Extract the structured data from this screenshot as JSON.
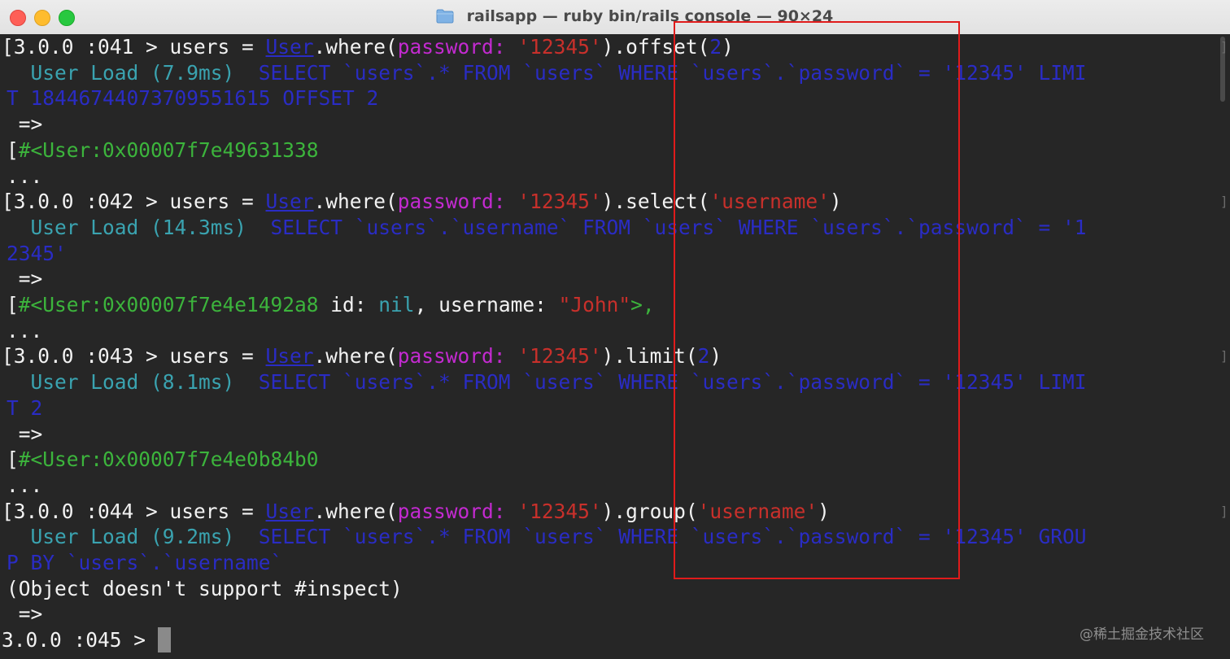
{
  "window": {
    "title": "railsapp — ruby bin/rails console — 90×24",
    "title_icon": "folder-icon",
    "close_glyph": "×"
  },
  "colors": {
    "background": "#262626",
    "prompt": "#f2f2f2",
    "log_label": "#3aa3b0",
    "sql": "#2a2cc4",
    "symbol_key": "#c32ad0",
    "string": "#c8302b",
    "object": "#3cb43c",
    "highlight_box": "#e01b1b"
  },
  "terminal": {
    "lines": [
      [
        {
          "t": "[3.0.0 :041 > users = ",
          "c": "white"
        },
        {
          "t": "User",
          "c": "blue",
          "u": true
        },
        {
          "t": ".where(",
          "c": "white"
        },
        {
          "t": "password: ",
          "c": "purple"
        },
        {
          "t": "'12345'",
          "c": "red"
        },
        {
          "t": ").offset(",
          "c": "white"
        },
        {
          "t": "2",
          "c": "blue"
        },
        {
          "t": ")",
          "c": "white"
        }
      ],
      [
        {
          "t": "  User Load (7.9ms)  ",
          "c": "cyan"
        },
        {
          "t": "SELECT `users`.* FROM `users` WHERE `users`.`password` = '12345' LIMI",
          "c": "blue"
        }
      ],
      [
        {
          "t": "T 18446744073709551615 OFFSET 2",
          "c": "blue"
        }
      ],
      [
        {
          "t": " =>",
          "c": "white"
        }
      ],
      [
        {
          "t": "[",
          "c": "white"
        },
        {
          "t": "#<User:0x00007f7e49631338",
          "c": "green"
        }
      ],
      [
        {
          "t": "...",
          "c": "white"
        }
      ],
      [
        {
          "t": "[3.0.0 :042 > users = ",
          "c": "white"
        },
        {
          "t": "User",
          "c": "blue",
          "u": true
        },
        {
          "t": ".where(",
          "c": "white"
        },
        {
          "t": "password: ",
          "c": "purple"
        },
        {
          "t": "'12345'",
          "c": "red"
        },
        {
          "t": ").select(",
          "c": "white"
        },
        {
          "t": "'username'",
          "c": "red"
        },
        {
          "t": ")",
          "c": "white"
        }
      ],
      [
        {
          "t": "  User Load (14.3ms)  ",
          "c": "cyan"
        },
        {
          "t": "SELECT `users`.`username` FROM `users` WHERE `users`.`password` = '1",
          "c": "blue"
        }
      ],
      [
        {
          "t": "2345'",
          "c": "blue"
        }
      ],
      [
        {
          "t": " =>",
          "c": "white"
        }
      ],
      [
        {
          "t": "[",
          "c": "white"
        },
        {
          "t": "#<User:0x00007f7e4e1492a8",
          "c": "green"
        },
        {
          "t": " id: ",
          "c": "white"
        },
        {
          "t": "nil",
          "c": "cyan"
        },
        {
          "t": ", username: ",
          "c": "white"
        },
        {
          "t": "\"John\"",
          "c": "red"
        },
        {
          "t": ">,",
          "c": "green"
        }
      ],
      [
        {
          "t": "...",
          "c": "white"
        }
      ],
      [
        {
          "t": "[3.0.0 :043 > users = ",
          "c": "white"
        },
        {
          "t": "User",
          "c": "blue",
          "u": true
        },
        {
          "t": ".where(",
          "c": "white"
        },
        {
          "t": "password: ",
          "c": "purple"
        },
        {
          "t": "'12345'",
          "c": "red"
        },
        {
          "t": ").limit(",
          "c": "white"
        },
        {
          "t": "2",
          "c": "blue"
        },
        {
          "t": ")",
          "c": "white"
        }
      ],
      [
        {
          "t": "  User Load (8.1ms)  ",
          "c": "cyan"
        },
        {
          "t": "SELECT `users`.* FROM `users` WHERE `users`.`password` = '12345' LIMI",
          "c": "blue"
        }
      ],
      [
        {
          "t": "T 2",
          "c": "blue"
        }
      ],
      [
        {
          "t": " =>",
          "c": "white"
        }
      ],
      [
        {
          "t": "[",
          "c": "white"
        },
        {
          "t": "#<User:0x00007f7e4e0b84b0",
          "c": "green"
        }
      ],
      [
        {
          "t": "...",
          "c": "white"
        }
      ],
      [
        {
          "t": "[3.0.0 :044 > users = ",
          "c": "white"
        },
        {
          "t": "User",
          "c": "blue",
          "u": true
        },
        {
          "t": ".where(",
          "c": "white"
        },
        {
          "t": "password: ",
          "c": "purple"
        },
        {
          "t": "'12345'",
          "c": "red"
        },
        {
          "t": ").group(",
          "c": "white"
        },
        {
          "t": "'username'",
          "c": "red"
        },
        {
          "t": ")",
          "c": "white"
        }
      ],
      [
        {
          "t": "  User Load (9.2ms)  ",
          "c": "cyan"
        },
        {
          "t": "SELECT `users`.* FROM `users` WHERE `users`.`password` = '12345' GROU",
          "c": "blue"
        }
      ],
      [
        {
          "t": "P BY `users`.`username`",
          "c": "blue"
        }
      ],
      [
        {
          "t": "(Object doesn't support #inspect)",
          "c": "white"
        }
      ],
      [
        {
          "t": " =>",
          "c": "white"
        }
      ],
      [
        {
          "t": "3.0.0 :045 > ",
          "c": "white"
        },
        {
          "cursor": true
        }
      ]
    ],
    "right_brackets": [
      "]",
      "]",
      "]",
      "]"
    ]
  },
  "watermark": "@稀土掘金技术社区"
}
